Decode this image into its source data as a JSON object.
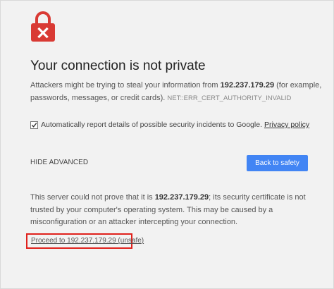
{
  "interstitial": {
    "title": "Your connection is not private",
    "description": {
      "before_ip": "Attackers might be trying to steal your information from ",
      "ip": "192.237.179.29",
      "after_ip": " (for example, passwords, messages, or credit cards).",
      "error_code": "NET::ERR_CERT_AUTHORITY_INVALID"
    },
    "report": {
      "checked": true,
      "label": "Automatically report details of possible security incidents to Google.",
      "privacy_link": "Privacy policy"
    },
    "hide_advanced_label": "HIDE ADVANCED",
    "back_button_label": "Back to safety",
    "details": {
      "before_ip": "This server could not prove that it is ",
      "ip": "192.237.179.29",
      "after_ip": "; its security certificate is not trusted by your computer's operating system. This may be caused by a misconfiguration or an attacker intercepting your connection."
    },
    "proceed_link": "Proceed to 192.237.179.29 (unsafe)",
    "colors": {
      "lock_red": "#d93a34",
      "button_blue": "#4285f4",
      "highlight_red": "#e0211c",
      "background": "#f2f2f2"
    }
  }
}
